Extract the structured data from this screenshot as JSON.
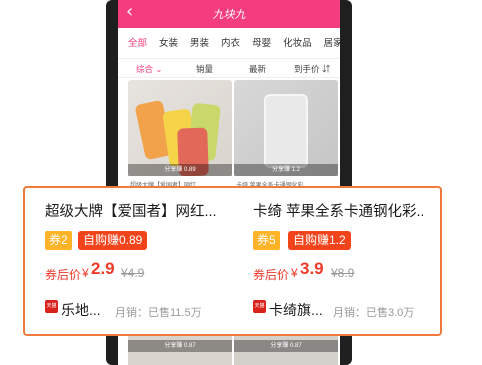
{
  "app": {
    "title": "九块九"
  },
  "categories": [
    "全部",
    "女装",
    "男装",
    "内衣",
    "母婴",
    "化妆品",
    "居家"
  ],
  "sort": {
    "items": [
      "综合",
      "销量",
      "最新",
      "到手价"
    ]
  },
  "grid": {
    "share_labels": [
      "分享赚 0.89",
      "分享赚 1.2"
    ],
    "title_peeks": [
      "超级大牌【爱国者】网红",
      "卡绮 苹果全系卡通钢化彩"
    ],
    "bottom_share_labels": [
      "分享赚 0.87",
      "分享赚 0.87"
    ]
  },
  "products": [
    {
      "title": "超级大牌【爱国者】网红...",
      "coupon": "券2",
      "earn": "自购赚0.89",
      "price_label": "券后价",
      "currency": "¥",
      "price": "2.9",
      "original_price": "¥4.9",
      "store_badge": "天猫",
      "shop": "乐地...",
      "sales": "月销：已售11.5万"
    },
    {
      "title": "卡绮 苹果全系卡通钢化彩...",
      "coupon": "券5",
      "earn": "自购赚1.2",
      "price_label": "券后价",
      "currency": "¥",
      "price": "3.9",
      "original_price": "¥8.9",
      "store_badge": "天猫",
      "shop": "卡绮旗...",
      "sales": "月销：已售3.0万"
    }
  ],
  "colors": {
    "brand": "#f43c7e",
    "price": "#ef3b2b",
    "coupon": "#ffb327",
    "earn": "#f2431b",
    "highlight_border": "#f07a3c"
  }
}
